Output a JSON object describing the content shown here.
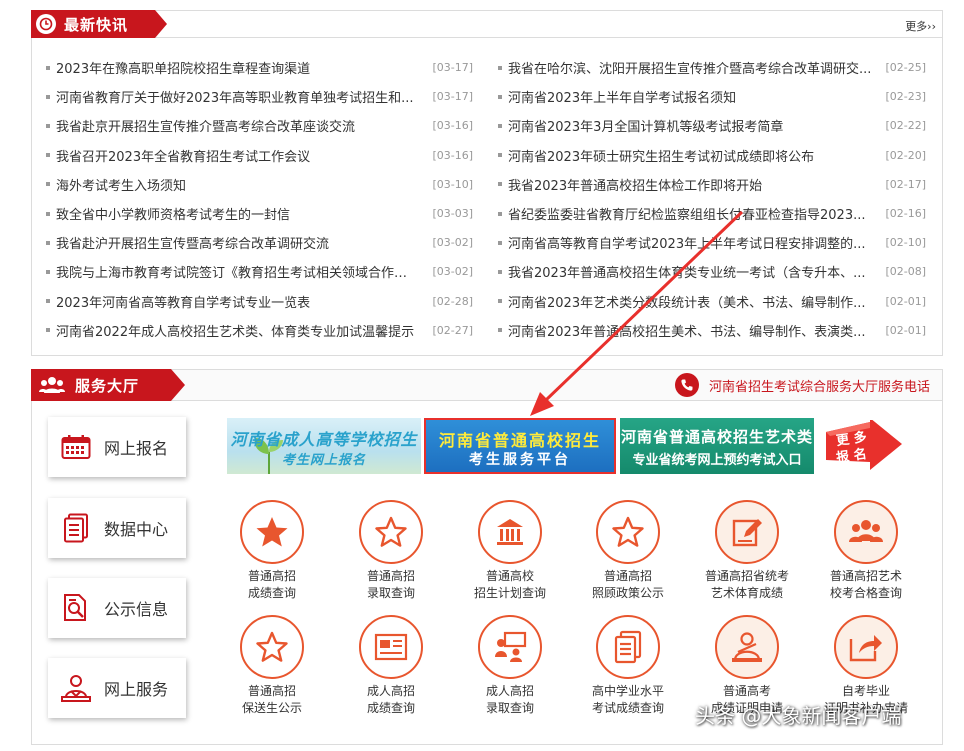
{
  "news": {
    "title": "最新快讯",
    "more": "更多››",
    "left": [
      {
        "title": "2023年在豫高职单招院校招生章程查询渠道",
        "date": "[03-17]"
      },
      {
        "title": "河南省教育厅关于做好2023年高等职业教育单独考试招生和...",
        "date": "[03-17]"
      },
      {
        "title": "我省赴京开展招生宣传推介暨高考综合改革座谈交流",
        "date": "[03-16]"
      },
      {
        "title": "我省召开2023年全省教育招生考试工作会议",
        "date": "[03-16]"
      },
      {
        "title": "海外考试考生入场须知",
        "date": "[03-10]"
      },
      {
        "title": "致全省中小学教师资格考试考生的一封信",
        "date": "[03-03]"
      },
      {
        "title": "我省赴沪开展招生宣传暨高考综合改革调研交流",
        "date": "[03-02]"
      },
      {
        "title": "我院与上海市教育考试院签订《教育招生考试相关领域合作框...",
        "date": "[03-02]"
      },
      {
        "title": "2023年河南省高等教育自学考试专业一览表",
        "date": "[02-28]"
      },
      {
        "title": "河南省2022年成人高校招生艺术类、体育类专业加试温馨提示",
        "date": "[02-27]"
      }
    ],
    "right": [
      {
        "title": "我省在哈尔滨、沈阳开展招生宣传推介暨高考综合改革调研交...",
        "date": "[02-25]"
      },
      {
        "title": "河南省2023年上半年自学考试报名须知",
        "date": "[02-23]"
      },
      {
        "title": "河南省2023年3月全国计算机等级考试报考简章",
        "date": "[02-22]"
      },
      {
        "title": "河南省2023年硕士研究生招生考试初试成绩即将公布",
        "date": "[02-20]"
      },
      {
        "title": "我省2023年普通高校招生体检工作即将开始",
        "date": "[02-17]"
      },
      {
        "title": "省纪委监委驻省教育厅纪检监察组组长付春亚检查指导2023...",
        "date": "[02-16]"
      },
      {
        "title": "河南省高等教育自学考试2023年上半年考试日程安排调整的...",
        "date": "[02-10]"
      },
      {
        "title": "我省2023年普通高校招生体育类专业统一考试（含专升本、...",
        "date": "[02-08]"
      },
      {
        "title": "河南省2023年艺术类分数段统计表（美术、书法、编导制作...",
        "date": "[02-01]"
      },
      {
        "title": "河南省2023年普通高校招生美术、书法、编导制作、表演类...",
        "date": "[02-01]"
      }
    ]
  },
  "service": {
    "title": "服务大厅",
    "hotline": "河南省招生考试综合服务大厅服务电话",
    "side": [
      {
        "label": "网上报名",
        "icon": "calendar-icon"
      },
      {
        "label": "数据中心",
        "icon": "document-stack-icon"
      },
      {
        "label": "公示信息",
        "icon": "search-document-icon"
      },
      {
        "label": "网上服务",
        "icon": "service-person-icon"
      }
    ],
    "banners": [
      {
        "line1": "河南省成人高等学校招生",
        "line2": "考生网上报名"
      },
      {
        "line1": "河南省普通高校招生",
        "line2": "考生服务平台"
      },
      {
        "line1": "河南省普通高校招生艺术类",
        "line2": "专业省统考网上预约考试入口"
      }
    ],
    "more_signup": {
      "line1": "更 多",
      "line2": "报 名"
    },
    "row1": [
      {
        "line1": "普通高招",
        "line2": "成绩查询",
        "icon": "star-icon"
      },
      {
        "line1": "普通高招",
        "line2": "录取查询",
        "icon": "star-outline-icon"
      },
      {
        "line1": "普通高校",
        "line2": "招生计划查询",
        "icon": "building-icon"
      },
      {
        "line1": "普通高招",
        "line2": "照顾政策公示",
        "icon": "star-outline-icon"
      },
      {
        "line1": "普通高招省统考",
        "line2": "艺术体育成绩",
        "icon": "edit-icon"
      },
      {
        "line1": "普通高招艺术",
        "line2": "校考合格查询",
        "icon": "group-icon"
      }
    ],
    "row2": [
      {
        "line1": "普通高招",
        "line2": "保送生公示",
        "icon": "star-outline-icon"
      },
      {
        "line1": "成人高招",
        "line2": "成绩查询",
        "icon": "certificate-icon"
      },
      {
        "line1": "成人高招",
        "line2": "录取查询",
        "icon": "presentation-icon"
      },
      {
        "line1": "高中学业水平",
        "line2": "考试成绩查询",
        "icon": "document-stack-icon"
      },
      {
        "line1": "普通高考",
        "line2": "成绩证明申请",
        "icon": "teacher-icon"
      },
      {
        "line1": "自考毕业",
        "line2": "证明书补办申请",
        "icon": "share-icon"
      }
    ]
  },
  "watermark": "头条 @大象新闻客户端",
  "colors": {
    "brand_red": "#c8161d",
    "icon_orange": "#e8562e",
    "border": "#dcdcdc"
  }
}
